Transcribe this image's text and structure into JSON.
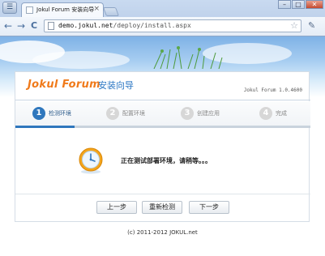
{
  "browser": {
    "tab_title": "Jokul Forum 安装向导",
    "tab_close": "×",
    "url_host": "demo.jokul.net",
    "url_path": "/deploy/install.aspx",
    "back_icon": "←",
    "forward_icon": "→",
    "reload_icon": "C",
    "star_icon": "☆",
    "wrench_icon": "✎",
    "window_buttons": [
      "–",
      "□",
      "✕"
    ]
  },
  "installer": {
    "brand": "Jokul Forum",
    "subtitle": "安装向导",
    "version": "Jokul Forum 1.0.4600",
    "steps": [
      {
        "num": "1",
        "label": "检测环境",
        "active": true
      },
      {
        "num": "2",
        "label": "配置环境",
        "active": false
      },
      {
        "num": "3",
        "label": "创建应用",
        "active": false
      },
      {
        "num": "4",
        "label": "完成",
        "active": false
      }
    ],
    "progress_fraction": 0.2,
    "status_text": "正在测试部署环境，请稍等。。。",
    "buttons": {
      "prev": "上一步",
      "recheck": "重新检测",
      "next": "下一步"
    }
  },
  "footer": {
    "copyright": "(c) 2011-2012 JOKUL.net"
  },
  "colors": {
    "brand_orange": "#f07a1a",
    "accent_blue": "#2f77bd",
    "step_inactive": "#d7d7d7"
  }
}
